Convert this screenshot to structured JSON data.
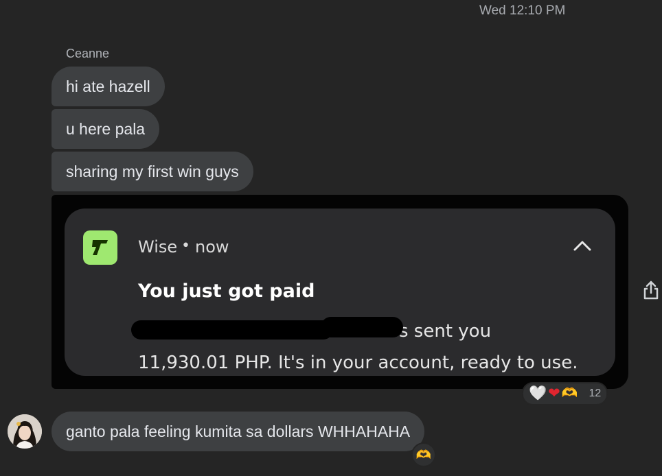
{
  "timestamp": "Wed 12:10 PM",
  "sender_name": "Ceanne",
  "messages": [
    {
      "text": "hi ate hazell"
    },
    {
      "text": "u here pala"
    },
    {
      "text": "sharing my first win guys"
    },
    {
      "text": "ganto pala feeling kumita sa dollars WHHAHAHA"
    }
  ],
  "notification": {
    "app_name": "Wise",
    "separator": "•",
    "time": "now",
    "title": "You just got paid",
    "body_line1": "s sent you",
    "body_line2": "11,930.01 PHP. It's in your account, ready to use.",
    "icon": "wise-logo-icon",
    "icon_color": "#9fe870"
  },
  "reactions": {
    "emojis": [
      "🤍",
      "❤",
      "🫶"
    ],
    "count": "12"
  },
  "small_reaction": "🫶",
  "colors": {
    "background": "#252525",
    "bubble": "#3e4042",
    "card": "#2b2b2d"
  }
}
